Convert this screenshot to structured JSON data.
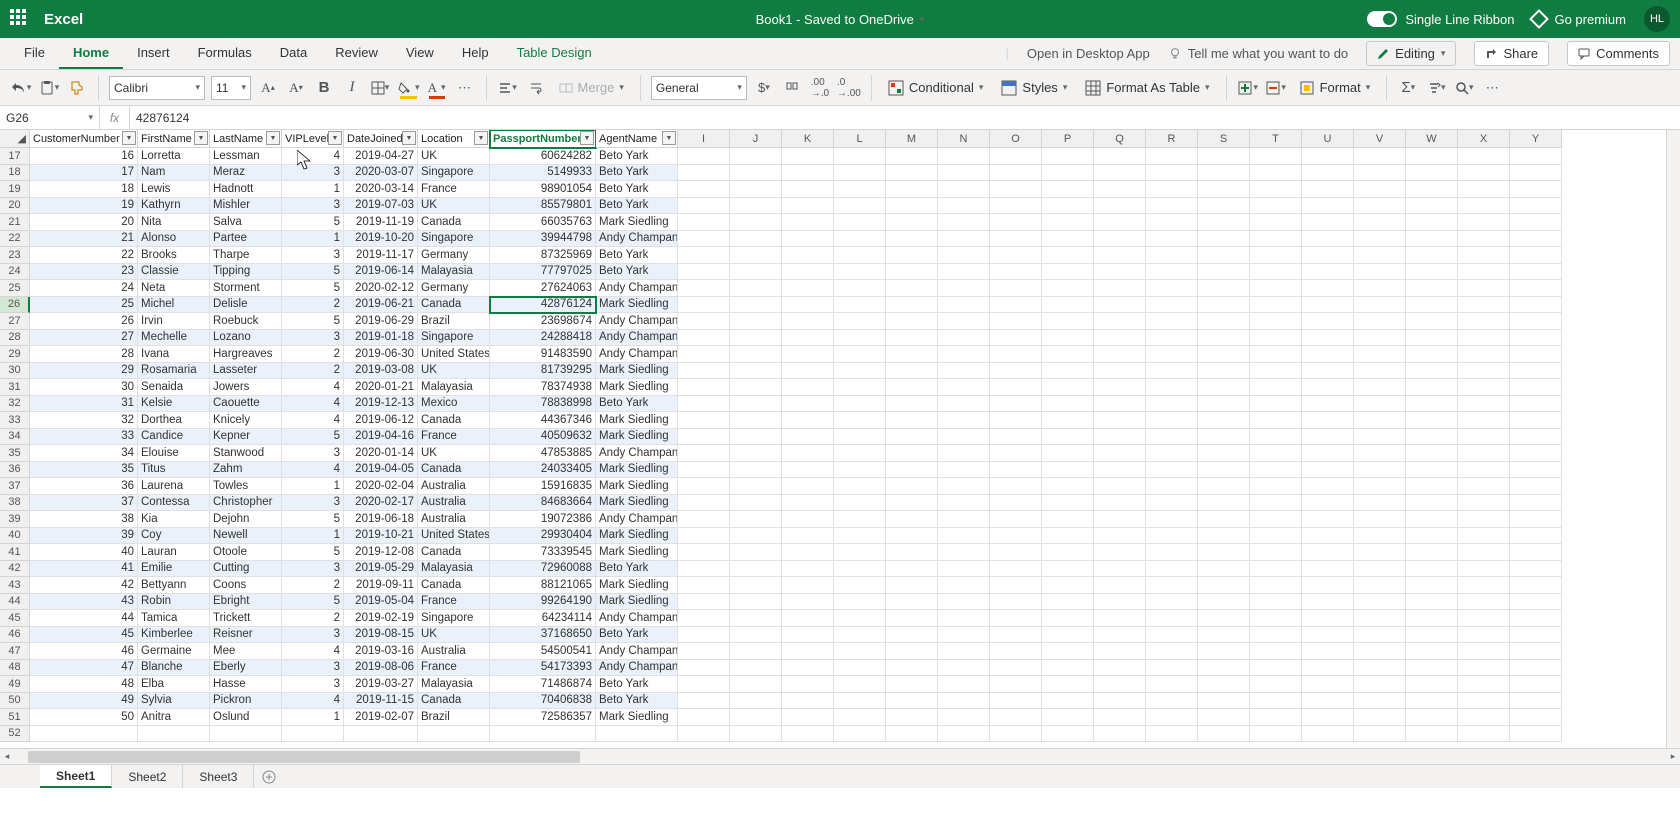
{
  "app": {
    "name": "Excel",
    "docTitle": "Book1 - Saved to OneDrive"
  },
  "titleRight": {
    "singleLine": "Single Line Ribbon",
    "premium": "Go premium",
    "initials": "HL"
  },
  "tabs": [
    "File",
    "Home",
    "Insert",
    "Formulas",
    "Data",
    "Review",
    "View",
    "Help",
    "Table Design"
  ],
  "tabsActive": "Home",
  "tabExtras": {
    "openDesktop": "Open in Desktop App",
    "tellMe": "Tell me what you want to do",
    "editing": "Editing",
    "share": "Share",
    "comments": "Comments"
  },
  "toolbar": {
    "fontName": "Calibri",
    "fontSize": "11",
    "numFmt": "General",
    "merge": "Merge",
    "conditional": "Conditional",
    "styles": "Styles",
    "formatTable": "Format As Table",
    "format": "Format"
  },
  "nameBox": "G26",
  "formula": "42876124",
  "columns": [
    {
      "key": "CustomerNumber",
      "label": "CustomerNumber",
      "align": "r"
    },
    {
      "key": "FirstName",
      "label": "FirstName",
      "align": "l"
    },
    {
      "key": "LastName",
      "label": "LastName",
      "align": "l"
    },
    {
      "key": "VIPLevel",
      "label": "VIPLevel",
      "align": "r"
    },
    {
      "key": "DateJoined",
      "label": "DateJoined",
      "align": "r"
    },
    {
      "key": "Location",
      "label": "Location",
      "align": "l"
    },
    {
      "key": "PassportNumber",
      "label": "PassportNumber",
      "align": "r",
      "selected": true
    },
    {
      "key": "AgentName",
      "label": "AgentName",
      "align": "l"
    }
  ],
  "extraCols": [
    "I",
    "J",
    "K",
    "L",
    "M",
    "N",
    "O",
    "P",
    "Q",
    "R",
    "S",
    "T",
    "U",
    "V",
    "W",
    "X",
    "Y"
  ],
  "startRow": 17,
  "activeCell": {
    "row": 26,
    "col": 6
  },
  "rows": [
    [
      16,
      "Lorretta",
      "Lessman",
      4,
      "2019-04-27",
      "UK",
      60624282,
      "Beto Yark"
    ],
    [
      17,
      "Nam",
      "Meraz",
      3,
      "2020-03-07",
      "Singapore",
      5149933,
      "Beto Yark"
    ],
    [
      18,
      "Lewis",
      "Hadnott",
      1,
      "2020-03-14",
      "France",
      98901054,
      "Beto Yark"
    ],
    [
      19,
      "Kathyrn",
      "Mishler",
      3,
      "2019-07-03",
      "UK",
      85579801,
      "Beto Yark"
    ],
    [
      20,
      "Nita",
      "Salva",
      5,
      "2019-11-19",
      "Canada",
      66035763,
      "Mark Siedling"
    ],
    [
      21,
      "Alonso",
      "Partee",
      1,
      "2019-10-20",
      "Singapore",
      39944798,
      "Andy Champan"
    ],
    [
      22,
      "Brooks",
      "Tharpe",
      3,
      "2019-11-17",
      "Germany",
      87325969,
      "Beto Yark"
    ],
    [
      23,
      "Classie",
      "Tipping",
      5,
      "2019-06-14",
      "Malayasia",
      77797025,
      "Beto Yark"
    ],
    [
      24,
      "Neta",
      "Storment",
      5,
      "2020-02-12",
      "Germany",
      27624063,
      "Andy Champan"
    ],
    [
      25,
      "Michel",
      "Delisle",
      2,
      "2019-06-21",
      "Canada",
      42876124,
      "Mark Siedling"
    ],
    [
      26,
      "Irvin",
      "Roebuck",
      5,
      "2019-06-29",
      "Brazil",
      23698674,
      "Andy Champan"
    ],
    [
      27,
      "Mechelle",
      "Lozano",
      3,
      "2019-01-18",
      "Singapore",
      24288418,
      "Andy Champan"
    ],
    [
      28,
      "Ivana",
      "Hargreaves",
      2,
      "2019-06-30",
      "United States",
      91483590,
      "Andy Champan"
    ],
    [
      29,
      "Rosamaria",
      "Lasseter",
      2,
      "2019-03-08",
      "UK",
      81739295,
      "Mark Siedling"
    ],
    [
      30,
      "Senaida",
      "Jowers",
      4,
      "2020-01-21",
      "Malayasia",
      78374938,
      "Mark Siedling"
    ],
    [
      31,
      "Kelsie",
      "Caouette",
      4,
      "2019-12-13",
      "Mexico",
      78838998,
      "Beto Yark"
    ],
    [
      32,
      "Dorthea",
      "Knicely",
      4,
      "2019-06-12",
      "Canada",
      44367346,
      "Mark Siedling"
    ],
    [
      33,
      "Candice",
      "Kepner",
      5,
      "2019-04-16",
      "France",
      40509632,
      "Mark Siedling"
    ],
    [
      34,
      "Elouise",
      "Stanwood",
      3,
      "2020-01-14",
      "UK",
      47853885,
      "Andy Champan"
    ],
    [
      35,
      "Titus",
      "Zahm",
      4,
      "2019-04-05",
      "Canada",
      24033405,
      "Mark Siedling"
    ],
    [
      36,
      "Laurena",
      "Towles",
      1,
      "2020-02-04",
      "Australia",
      15916835,
      "Mark Siedling"
    ],
    [
      37,
      "Contessa",
      "Christopher",
      3,
      "2020-02-17",
      "Australia",
      84683664,
      "Mark Siedling"
    ],
    [
      38,
      "Kia",
      "Dejohn",
      5,
      "2019-06-18",
      "Australia",
      19072386,
      "Andy Champan"
    ],
    [
      39,
      "Coy",
      "Newell",
      1,
      "2019-10-21",
      "United States",
      29930404,
      "Mark Siedling"
    ],
    [
      40,
      "Lauran",
      "Otoole",
      5,
      "2019-12-08",
      "Canada",
      73339545,
      "Mark Siedling"
    ],
    [
      41,
      "Emilie",
      "Cutting",
      3,
      "2019-05-29",
      "Malayasia",
      72960088,
      "Beto Yark"
    ],
    [
      42,
      "Bettyann",
      "Coons",
      2,
      "2019-09-11",
      "Canada",
      88121065,
      "Mark Siedling"
    ],
    [
      43,
      "Robin",
      "Ebright",
      5,
      "2019-05-04",
      "France",
      99264190,
      "Mark Siedling"
    ],
    [
      44,
      "Tamica",
      "Trickett",
      2,
      "2019-02-19",
      "Singapore",
      64234114,
      "Andy Champan"
    ],
    [
      45,
      "Kimberlee",
      "Reisner",
      3,
      "2019-08-15",
      "UK",
      37168650,
      "Beto Yark"
    ],
    [
      46,
      "Germaine",
      "Mee",
      4,
      "2019-03-16",
      "Australia",
      54500541,
      "Andy Champan"
    ],
    [
      47,
      "Blanche",
      "Eberly",
      3,
      "2019-08-06",
      "France",
      54173393,
      "Andy Champan"
    ],
    [
      48,
      "Elba",
      "Hasse",
      3,
      "2019-03-27",
      "Malayasia",
      71486874,
      "Beto Yark"
    ],
    [
      49,
      "Sylvia",
      "Pickron",
      4,
      "2019-11-15",
      "Canada",
      70406838,
      "Beto Yark"
    ],
    [
      50,
      "Anitra",
      "Oslund",
      1,
      "2019-02-07",
      "Brazil",
      72586357,
      "Mark Siedling"
    ]
  ],
  "sheets": [
    "Sheet1",
    "Sheet2",
    "Sheet3"
  ],
  "activeSheet": "Sheet1"
}
